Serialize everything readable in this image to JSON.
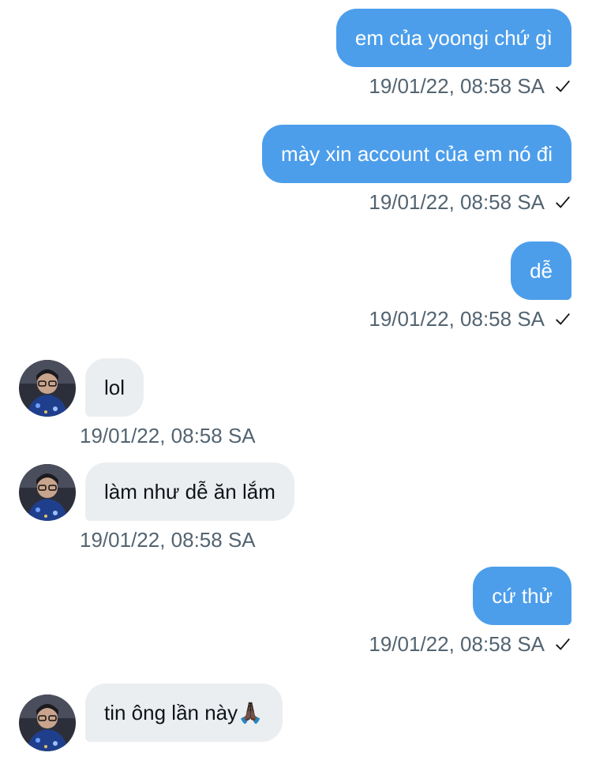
{
  "conversation": {
    "messages": [
      {
        "direction": "out",
        "text": "em của yoongi chứ gì",
        "timestamp": "19/01/22, 08:58 SA"
      },
      {
        "direction": "out",
        "text": "mày xin account của em nó đi",
        "timestamp": "19/01/22, 08:58 SA"
      },
      {
        "direction": "out",
        "text": "dễ",
        "timestamp": "19/01/22, 08:58 SA"
      },
      {
        "direction": "in",
        "text": "lol",
        "timestamp": "19/01/22, 08:58 SA"
      },
      {
        "direction": "in",
        "text": "làm như dễ ăn lắm",
        "timestamp": "19/01/22, 08:58 SA"
      },
      {
        "direction": "out",
        "text": "cứ thử",
        "timestamp": "19/01/22, 08:58 SA"
      },
      {
        "direction": "in",
        "text": "tin ông lần này🙏🏿",
        "timestamp": ""
      }
    ]
  },
  "colors": {
    "outgoing_bubble": "#4c9eeb",
    "incoming_bubble": "#ebeef0",
    "timestamp_text": "#536471"
  },
  "icons": {
    "sent_status": "checkmark-icon",
    "contact_avatar": "avatar-icon"
  }
}
